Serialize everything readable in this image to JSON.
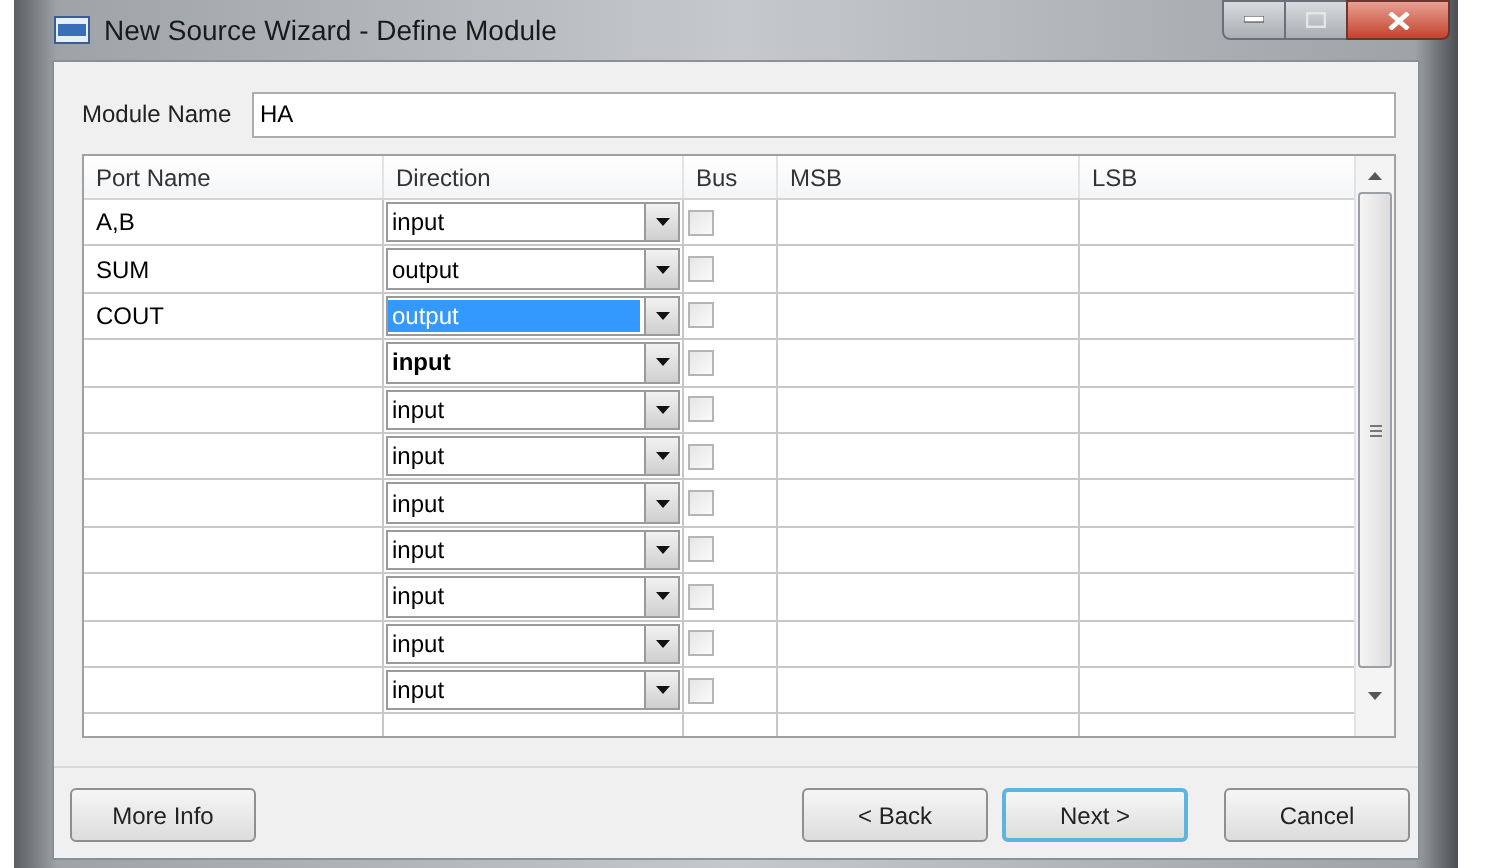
{
  "window": {
    "title": "New Source Wizard - Define Module"
  },
  "module_name": {
    "label": "Module Name",
    "value": "HA"
  },
  "table": {
    "columns": [
      "Port Name",
      "Direction",
      "Bus",
      "MSB",
      "LSB"
    ],
    "rows": [
      {
        "port_name": "A,B",
        "direction": "input",
        "selected": false,
        "bold": false,
        "bus_checked": false
      },
      {
        "port_name": "SUM",
        "direction": "output",
        "selected": false,
        "bold": false,
        "bus_checked": false
      },
      {
        "port_name": "COUT",
        "direction": "output",
        "selected": true,
        "bold": false,
        "bus_checked": false
      },
      {
        "direction": "input",
        "selected": false,
        "bold": true,
        "bus_checked": false
      },
      {
        "direction": "input",
        "selected": false,
        "bold": false,
        "bus_checked": false
      },
      {
        "direction": "input",
        "selected": false,
        "bold": false,
        "bus_checked": false
      },
      {
        "direction": "input",
        "selected": false,
        "bold": false,
        "bus_checked": false
      },
      {
        "direction": "input",
        "selected": false,
        "bold": false,
        "bus_checked": false
      },
      {
        "direction": "input",
        "selected": false,
        "bold": false,
        "bus_checked": false
      },
      {
        "direction": "input",
        "selected": false,
        "bold": false,
        "bus_checked": false
      },
      {
        "direction": "input",
        "selected": false,
        "bold": false,
        "bus_checked": false
      }
    ]
  },
  "buttons": [
    {
      "label": "More Info",
      "kind": "left",
      "default": false
    },
    {
      "label": "< Back",
      "kind": "right",
      "default": false
    },
    {
      "label": "Next >",
      "kind": "right",
      "default": true
    },
    {
      "label": "Cancel",
      "kind": "right",
      "default": false
    }
  ]
}
